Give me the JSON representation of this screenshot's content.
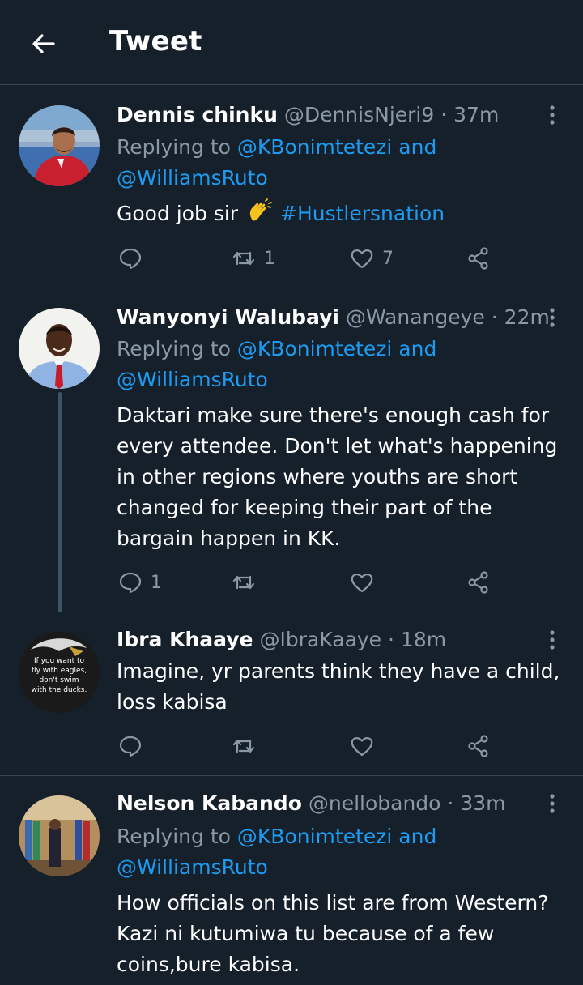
{
  "header": {
    "title": "Tweet",
    "back_icon": "arrow-left-icon"
  },
  "tweets": [
    {
      "name": "Dennis chinku",
      "handle": "@DennisNjeri9",
      "sep": "·",
      "time": "37m",
      "replying_prefix": "Replying to",
      "reply_to_1": "@KBonimtetezi",
      "reply_and": "and",
      "reply_to_2": "@WilliamsRuto",
      "text": "Good job sir",
      "emoji": "clapping-hands",
      "hashtag": "#Hustlersnation",
      "replies": "",
      "retweets": "1",
      "likes": "7"
    },
    {
      "name": "Wanyonyi Walubayi",
      "handle": "@Wanangeye",
      "sep": "·",
      "time": "22m",
      "replying_prefix": "Replying to",
      "reply_to_1": "@KBonimtetezi",
      "reply_and": "and",
      "reply_to_2": "@WilliamsRuto",
      "text_lines": [
        "Daktari make sure there's enough cash for",
        "every attendee. Don't let what's happening",
        "in other regions where youths are short",
        "changed for keeping their part of the",
        "bargain happen in KK."
      ],
      "replies": "1",
      "retweets": "",
      "likes": ""
    },
    {
      "name": "Ibra Khaaye",
      "handle": "@IbraKaaye",
      "sep": "·",
      "time": "18m",
      "avatar_text": [
        "If you want to",
        "fly with eagles,",
        "don't swim",
        "with the ducks."
      ],
      "text_lines": [
        "Imagine, yr parents think they have a child,",
        "loss kabisa"
      ],
      "replies": "",
      "retweets": "",
      "likes": ""
    },
    {
      "name": "Nelson Kabando",
      "handle": "@nellobando",
      "sep": "·",
      "time": "33m",
      "replying_prefix": "Replying to",
      "reply_to_1": "@KBonimtetezi",
      "reply_and": "and",
      "reply_to_2": "@WilliamsRuto",
      "text_lines": [
        "How officials on this list are from Western?",
        "Kazi ni kutumiwa tu because of a few",
        "coins,bure kabisa."
      ]
    }
  ],
  "colors": {
    "background": "#15202b",
    "divider": "#38444d",
    "secondary_text": "#8b98a5",
    "accent": "#1d9bf0"
  }
}
